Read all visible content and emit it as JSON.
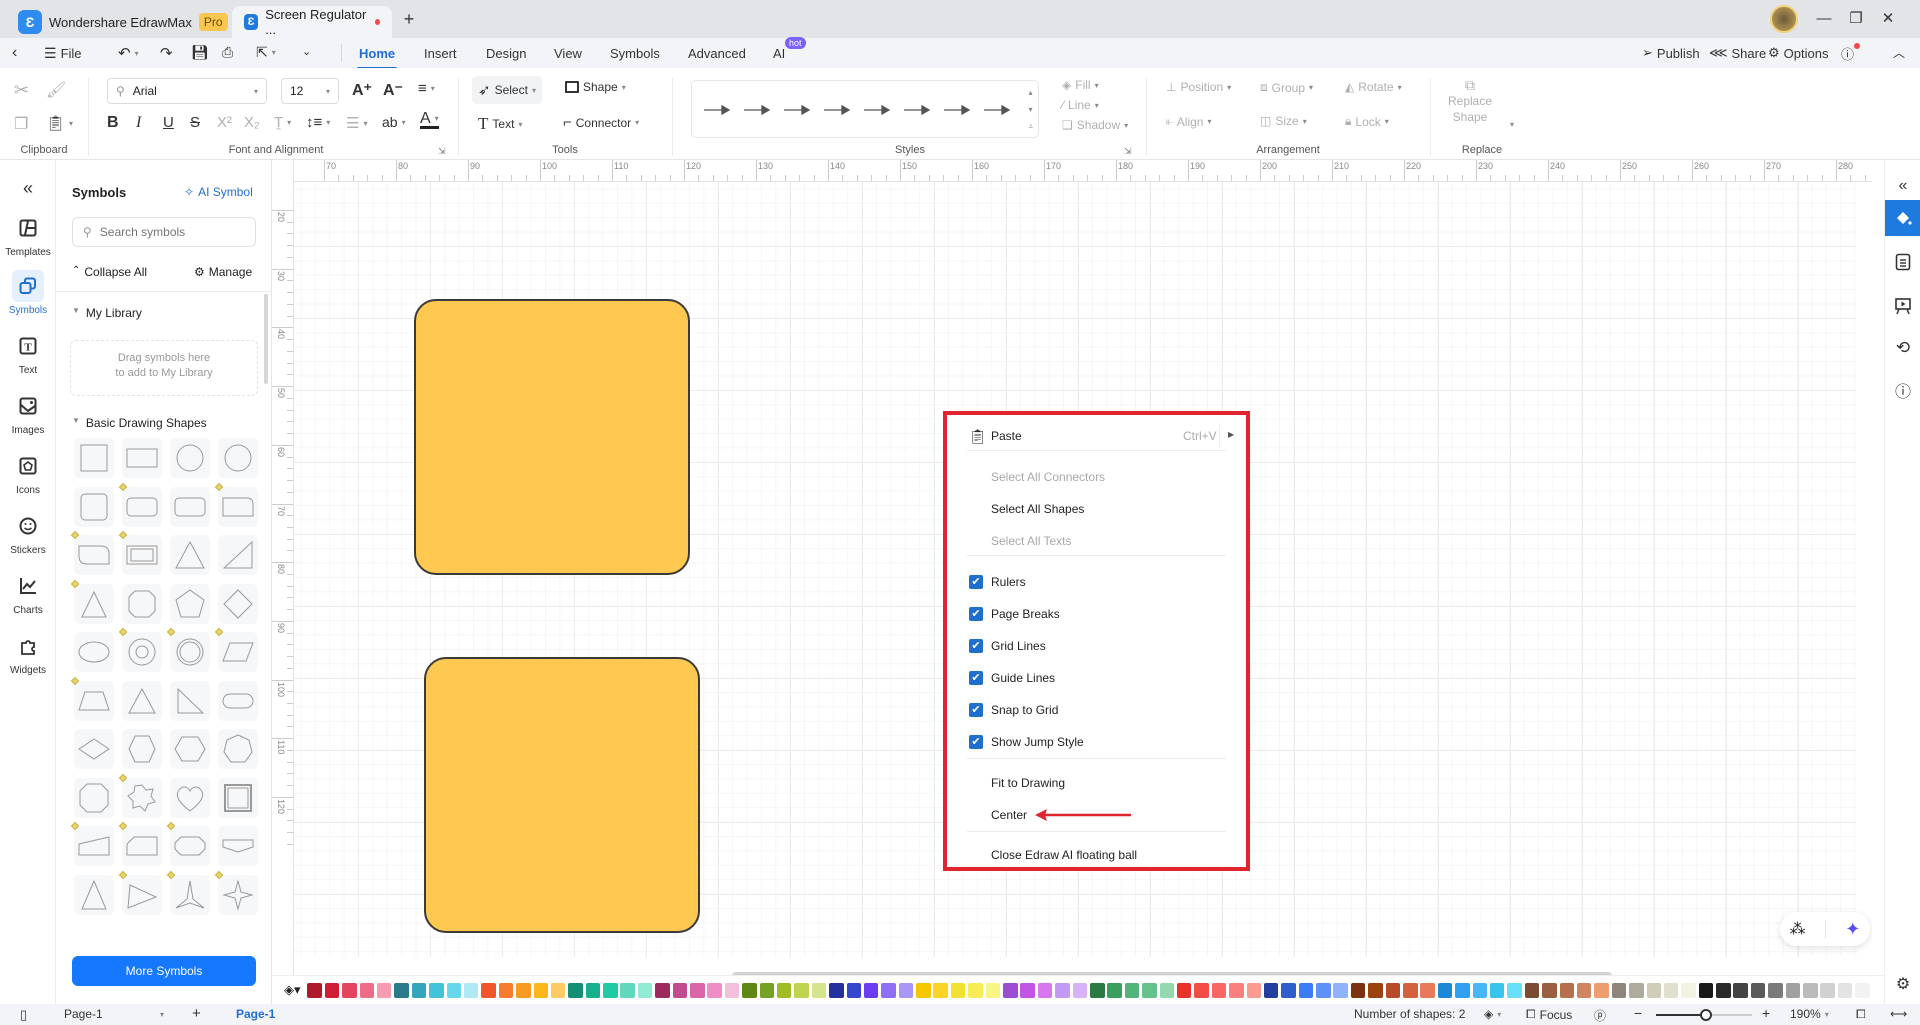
{
  "titlebar": {
    "app_name": "Wondershare EdrawMax",
    "badge": "Pro",
    "doc_tab": "Screen Regulator ...",
    "new_tab": "+"
  },
  "menubar": {
    "file": "File",
    "tabs": [
      "Home",
      "Insert",
      "Design",
      "View",
      "Symbols",
      "Advanced",
      "AI"
    ],
    "active_tab": "Home",
    "ai_badge": "hot",
    "publish": "Publish",
    "share": "Share",
    "options": "Options"
  },
  "ribbon": {
    "clipboard_label": "Clipboard",
    "font_family": "Arial",
    "font_size": "12",
    "font_label": "Font and Alignment",
    "select": "Select",
    "shape": "Shape",
    "text": "Text",
    "connector": "Connector",
    "tools_label": "Tools",
    "styles_label": "Styles",
    "fill": "Fill",
    "line": "Line",
    "shadow": "Shadow",
    "position": "Position",
    "group": "Group",
    "rotate": "Rotate",
    "align": "Align",
    "size": "Size",
    "lock": "Lock",
    "arrangement_label": "Arrangement",
    "replace_shape_1": "Replace",
    "replace_shape_2": "Shape",
    "replace_label": "Replace"
  },
  "leftbar": {
    "items": [
      "Templates",
      "Symbols",
      "Text",
      "Images",
      "Icons",
      "Stickers",
      "Charts",
      "Widgets"
    ],
    "active": "Symbols"
  },
  "symbols": {
    "title": "Symbols",
    "ai_symbol": "AI Symbol",
    "search_placeholder": "Search symbols",
    "collapse_all": "Collapse All",
    "manage": "Manage",
    "my_library": "My Library",
    "drop_hint_1": "Drag symbols here",
    "drop_hint_2": "to add to My Library",
    "basic_shapes": "Basic Drawing Shapes",
    "more_symbols": "More Symbols"
  },
  "rulers": {
    "horizontal": [
      "70",
      "80",
      "90",
      "100",
      "110",
      "120",
      "130",
      "140",
      "150",
      "160",
      "170",
      "180",
      "190",
      "200",
      "210",
      "220",
      "230",
      "240",
      "250",
      "260",
      "270",
      "280"
    ],
    "vertical": [
      "20",
      "30",
      "40",
      "50",
      "60",
      "70",
      "80",
      "90",
      "100",
      "110",
      "120"
    ]
  },
  "canvas": {
    "shape_fill": "#fec851",
    "shape_stroke": "#3a3a3a"
  },
  "context_menu": {
    "paste": "Paste",
    "paste_shortcut": "Ctrl+V",
    "select_all_connectors": "Select All Connectors",
    "select_all_shapes": "Select All Shapes",
    "select_all_texts": "Select All Texts",
    "checks": [
      {
        "label": "Rulers",
        "checked": true
      },
      {
        "label": "Page Breaks",
        "checked": true
      },
      {
        "label": "Grid Lines",
        "checked": true
      },
      {
        "label": "Guide Lines",
        "checked": true
      },
      {
        "label": "Snap to Grid",
        "checked": true
      },
      {
        "label": "Show Jump Style",
        "checked": true
      }
    ],
    "fit_to_drawing": "Fit to Drawing",
    "center": "Center",
    "close_ai_ball": "Close Edraw AI floating ball",
    "highlight_color": "#e0252e"
  },
  "palette": [
    "#b0192a",
    "#d01c36",
    "#e4455e",
    "#ee6d86",
    "#f59cb0",
    "#2b7a8c",
    "#35a4bd",
    "#43c2dc",
    "#66d8ee",
    "#aee9f5",
    "#f0552b",
    "#f87b2e",
    "#fa9b21",
    "#fbb61c",
    "#fdcb63",
    "#128f75",
    "#17b08f",
    "#22c9a5",
    "#5fd8bb",
    "#92ead3",
    "#9d2a5d",
    "#c24a8e",
    "#dc64a9",
    "#f08dc8",
    "#f2bfdc",
    "#5f8713",
    "#74a224",
    "#a1bd25",
    "#bfd54d",
    "#d5e58c",
    "#23309e",
    "#3446cc",
    "#6a3df0",
    "#8e6ff5",
    "#a997f7",
    "#f7c600",
    "#fbd426",
    "#f4e12f",
    "#f7ec55",
    "#f9f585",
    "#9c4bd2",
    "#c454e6",
    "#d877ed",
    "#c29af5",
    "#d7b2f9",
    "#2b7a42",
    "#3a9e5c",
    "#52b37b",
    "#66c28c",
    "#93d9ad",
    "#e8322a",
    "#f44c44",
    "#f86766",
    "#fa807b",
    "#fb9a91",
    "#223f9e",
    "#2e5dcc",
    "#3c7cf5",
    "#5d91f7",
    "#8fb2f8",
    "#7a3211",
    "#9c420e",
    "#b8492a",
    "#d5603e",
    "#e87a5b",
    "#1c88d6",
    "#2ea0ef",
    "#49b6f9",
    "#37c5f0",
    "#69def9",
    "#7a4a32",
    "#9a5e40",
    "#b56f4d",
    "#cf8660",
    "#ee9d6f",
    "#8e867c",
    "#afab9c",
    "#cfcdb7",
    "#e1e0cf",
    "#f3f2e3",
    "#1a1a1a",
    "#2b2b2b",
    "#444444",
    "#5a5a5a",
    "#7a7a7a",
    "#a0a0a0",
    "#bbbbbb",
    "#d1d1d1",
    "#e3e3e3",
    "#f2f2f2"
  ],
  "status": {
    "page_select": "Page-1",
    "page_tab": "Page-1",
    "shapes_count": "Number of shapes: 2",
    "focus": "Focus",
    "zoom": "190%",
    "zoom_fraction": 0.52
  }
}
